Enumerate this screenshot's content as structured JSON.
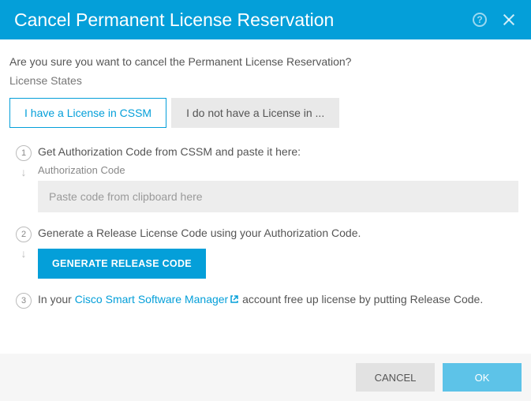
{
  "header": {
    "title": "Cancel Permanent License Reservation"
  },
  "confirm_text": "Are you sure you want to cancel the Permanent License Reservation?",
  "subheader": "License States",
  "tabs": {
    "active": "I have a License in CSSM",
    "inactive": "I do not have a License in ..."
  },
  "steps": {
    "s1": {
      "num": "1",
      "title": "Get Authorization Code from CSSM and paste it here:",
      "field_label": "Authorization Code",
      "placeholder": "Paste code from clipboard here"
    },
    "s2": {
      "num": "2",
      "title": "Generate a Release License Code using your Authorization Code.",
      "button": "GENERATE RELEASE CODE"
    },
    "s3": {
      "num": "3",
      "prefix": "In your ",
      "link": "Cisco Smart Software Manager",
      "suffix": " account free up license by putting Release Code."
    }
  },
  "footer": {
    "cancel": "CANCEL",
    "ok": "OK"
  }
}
